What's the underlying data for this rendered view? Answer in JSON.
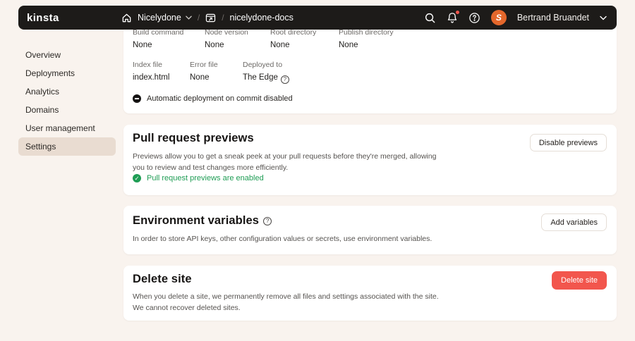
{
  "header": {
    "logo": "kinsta",
    "breadcrumb": {
      "company": "Nicelydone",
      "separator1": "/",
      "separator2": "/",
      "site": "nicelydone-docs"
    },
    "user_name": "Bertrand Bruandet",
    "avatar_initial": "S"
  },
  "sidebar": {
    "items": [
      {
        "label": "Overview"
      },
      {
        "label": "Deployments"
      },
      {
        "label": "Analytics"
      },
      {
        "label": "Domains"
      },
      {
        "label": "User management"
      },
      {
        "label": "Settings"
      }
    ]
  },
  "build_settings": {
    "fields_row1": [
      {
        "label": "Build command",
        "value": "None"
      },
      {
        "label": "Node version",
        "value": "None"
      },
      {
        "label": "Root directory",
        "value": "None"
      },
      {
        "label": "Publish directory",
        "value": "None"
      }
    ],
    "fields_row2": [
      {
        "label": "Index file",
        "value": "index.html"
      },
      {
        "label": "Error file",
        "value": "None"
      },
      {
        "label": "Deployed to",
        "value": "The Edge"
      }
    ],
    "status": "Automatic deployment on commit disabled"
  },
  "pull_request_previews": {
    "title": "Pull request previews",
    "button_label": "Disable previews",
    "description": "Previews allow you to get a sneak peek at your pull requests before they're merged, allowing\nyou to review and test changes more efficiently.",
    "status": "Pull request previews are enabled"
  },
  "environment_variables": {
    "title": "Environment variables",
    "button_label": "Add variables",
    "description": "In order to store API keys, other configuration values or secrets, use environment variables."
  },
  "delete_site": {
    "title": "Delete site",
    "button_label": "Delete site",
    "description": "When you delete a site, we permanently remove all files and settings associated with the site.\nWe cannot recover deleted sites."
  },
  "colors": {
    "header_bg": "#1d1b19",
    "page_bg": "#f9f3ee",
    "accent_red": "#f2564d",
    "success_green": "#1f9d55",
    "active_item_bg": "#e9dcd1",
    "avatar_orange": "#e4672b"
  }
}
